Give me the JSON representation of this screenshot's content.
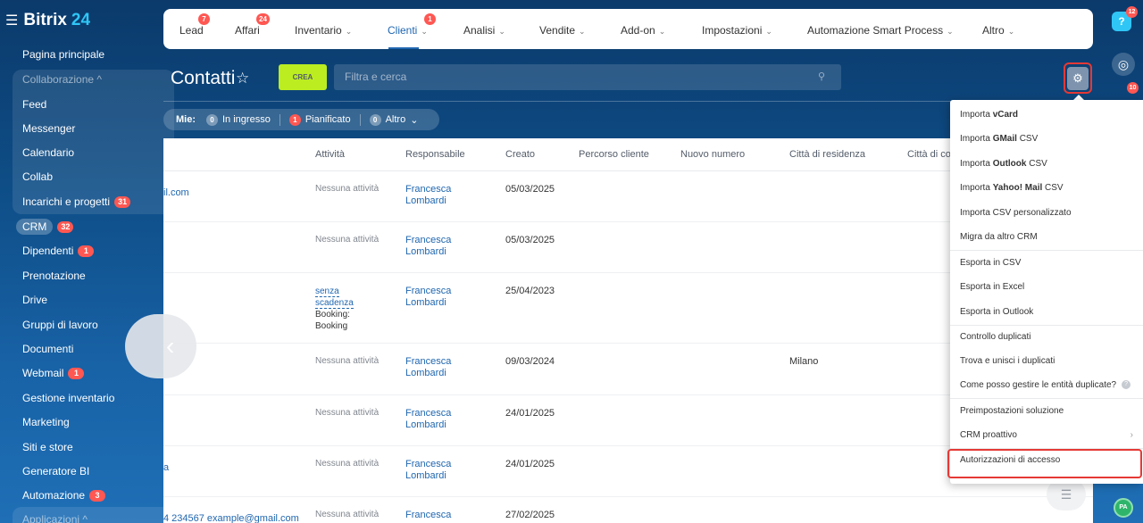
{
  "brand": {
    "name": "Bitrix",
    "num": "24"
  },
  "sidebar": {
    "items": [
      {
        "label": "Pagina principale"
      },
      {
        "label": "Collaborazione ^"
      },
      {
        "label": "Feed"
      },
      {
        "label": "Messenger"
      },
      {
        "label": "Calendario"
      },
      {
        "label": "Collab"
      },
      {
        "label": "Incarichi e progetti",
        "badge": "31"
      },
      {
        "label": "CRM",
        "badge": "32"
      },
      {
        "label": "Dipendenti",
        "badge": "1"
      },
      {
        "label": "Prenotazione"
      },
      {
        "label": "Drive"
      },
      {
        "label": "Gruppi di lavoro"
      },
      {
        "label": "Documenti"
      },
      {
        "label": "Webmail",
        "badge": "1"
      },
      {
        "label": "Gestione inventario"
      },
      {
        "label": "Marketing"
      },
      {
        "label": "Siti e store"
      },
      {
        "label": "Generatore BI"
      },
      {
        "label": "Automazione",
        "badge": "3"
      },
      {
        "label": "Applicazioni ^"
      }
    ]
  },
  "topnav": {
    "items": [
      {
        "label": "Lead",
        "badge": "7"
      },
      {
        "label": "Affari",
        "badge": "24"
      },
      {
        "label": "Inventario"
      },
      {
        "label": "Clienti",
        "badge": "1"
      },
      {
        "label": "Analisi"
      },
      {
        "label": "Vendite"
      },
      {
        "label": "Add-on"
      },
      {
        "label": "Impostazioni"
      },
      {
        "label": "Automazione Smart Process"
      },
      {
        "label": "Altro"
      }
    ]
  },
  "page": {
    "title": "Contatti",
    "create_label": "CREA",
    "search_placeholder": "Filtra e cerca"
  },
  "counters": {
    "label": "Mie:",
    "items": [
      {
        "num": "0",
        "label": "In ingresso"
      },
      {
        "num": "1",
        "label": "Pianificato"
      },
      {
        "num": "0",
        "label": "Altro"
      }
    ]
  },
  "table": {
    "headers": [
      "Attività",
      "Responsabile",
      "Creato",
      "Percorso cliente",
      "Nuovo numero",
      "Città di residenza",
      "Città di co"
    ],
    "rows": [
      {
        "contact": "il.com",
        "activity": "Nessuna attività",
        "owner_1": "Francesca",
        "owner_2": "Lombardi",
        "created": "05/03/2025",
        "city": ""
      },
      {
        "contact": "",
        "activity": "Nessuna attività",
        "owner_1": "Francesca",
        "owner_2": "Lombardi",
        "created": "05/03/2025",
        "city": ""
      },
      {
        "contact": "",
        "activity_1": "senza",
        "activity_2": "scadenza",
        "activity_3": "Booking:",
        "activity_4": "Booking",
        "owner_1": "Francesca",
        "owner_2": "Lombardi",
        "created": "25/04/2023",
        "city": ""
      },
      {
        "contact": "",
        "activity": "Nessuna attività",
        "owner_1": "Francesca",
        "owner_2": "Lombardi",
        "created": "09/03/2024",
        "city": "Milano"
      },
      {
        "contact": "",
        "activity": "Nessuna attività",
        "owner_1": "Francesca",
        "owner_2": "Lombardi",
        "created": "24/01/2025",
        "city": ""
      },
      {
        "contact": "a",
        "activity": "Nessuna attività",
        "owner_1": "Francesca",
        "owner_2": "Lombardi",
        "created": "24/01/2025",
        "city": ""
      },
      {
        "contact": "4 234567 example@gmail.com",
        "activity": "Nessuna attività",
        "owner_1": "Francesca",
        "owner_2": "",
        "created": "27/02/2025",
        "city": ""
      }
    ]
  },
  "right_bar": {
    "help_badge": "12",
    "bell_badge": "10",
    "avatar": "PA"
  },
  "menu": {
    "items": [
      {
        "pre": "Importa ",
        "bold": "vCard",
        "post": ""
      },
      {
        "pre": "Importa ",
        "bold": "GMail",
        "post": " CSV"
      },
      {
        "pre": "Importa ",
        "bold": "Outlook",
        "post": " CSV"
      },
      {
        "pre": "Importa ",
        "bold": "Yahoo! Mail",
        "post": " CSV"
      },
      {
        "pre": "Importa CSV personalizzato",
        "bold": "",
        "post": ""
      },
      {
        "pre": "Migra da altro CRM",
        "bold": "",
        "post": ""
      },
      {
        "pre": "Esporta in CSV",
        "bold": "",
        "post": ""
      },
      {
        "pre": "Esporta in Excel",
        "bold": "",
        "post": ""
      },
      {
        "pre": "Esporta in Outlook",
        "bold": "",
        "post": ""
      },
      {
        "pre": "Controllo duplicati",
        "bold": "",
        "post": ""
      },
      {
        "pre": "Trova e unisci i duplicati",
        "bold": "",
        "post": ""
      },
      {
        "pre": "Come posso gestire le entità duplicate?",
        "bold": "",
        "post": ""
      },
      {
        "pre": "Preimpostazioni soluzione",
        "bold": "",
        "post": ""
      },
      {
        "pre": "CRM proattivo",
        "bold": "",
        "post": ""
      },
      {
        "pre": "Autorizzazioni di accesso",
        "bold": "",
        "post": ""
      }
    ]
  },
  "icons": {
    "burger": "burger-menu-icon",
    "star": "star-icon",
    "search": "search-icon",
    "gear": "gear-icon",
    "help": "help-icon",
    "copilot": "copilot-icon",
    "chat": "chat-icon"
  },
  "colors": {
    "accent": "#2067b0",
    "create": "#bbed21",
    "badge": "#ff5752",
    "highlight": "#e53935",
    "brand_num": "#2fc6f6"
  }
}
